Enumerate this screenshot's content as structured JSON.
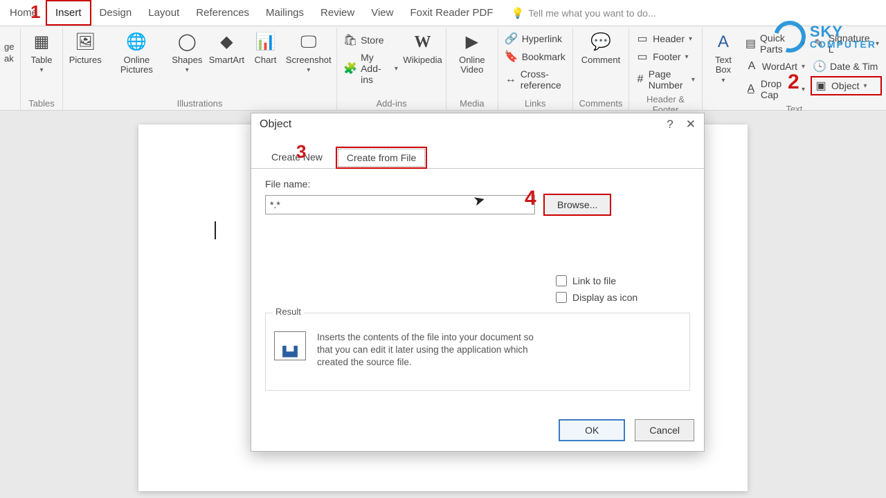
{
  "tabs": {
    "home": "Home",
    "insert": "Insert",
    "design": "Design",
    "layout": "Layout",
    "references": "References",
    "mailings": "Mailings",
    "review": "Review",
    "view": "View",
    "foxit": "Foxit Reader PDF",
    "tellme": "Tell me what you want to do..."
  },
  "ribbon": {
    "left_trunc_top": "ge",
    "left_trunc_bot": "ak",
    "tables": {
      "table": "Table",
      "group": "Tables"
    },
    "illus": {
      "pictures": "Pictures",
      "online_pictures": "Online Pictures",
      "shapes": "Shapes",
      "smartart": "SmartArt",
      "chart": "Chart",
      "screenshot": "Screenshot",
      "group": "Illustrations"
    },
    "addins": {
      "store": "Store",
      "myaddins": "My Add-ins",
      "wikipedia": "Wikipedia",
      "group": "Add-ins"
    },
    "media": {
      "online_video": "Online Video",
      "group": "Media"
    },
    "links": {
      "hyperlink": "Hyperlink",
      "bookmark": "Bookmark",
      "cross": "Cross-reference",
      "group": "Links"
    },
    "comments": {
      "comment": "Comment",
      "group": "Comments"
    },
    "hf": {
      "header": "Header",
      "footer": "Footer",
      "pagenum": "Page Number",
      "group": "Header & Footer"
    },
    "text": {
      "textbox": "Text Box",
      "quickparts": "Quick Parts",
      "wordart": "WordArt",
      "dropcap": "Drop Cap",
      "signature": "Signature L",
      "datetime": "Date & Tim",
      "object": "Object",
      "group": "Text"
    }
  },
  "dialog": {
    "title": "Object",
    "help": "?",
    "close": "✕",
    "tab_create_new": "Create New",
    "tab_create_file": "Create from File",
    "file_label": "File name:",
    "file_value": "*.*",
    "browse": "Browse...",
    "link": "Link to file",
    "display_icon": "Display as icon",
    "result_title": "Result",
    "result_text": "Inserts the contents of the file into your document so that you can edit it later using the application which created the source file.",
    "ok": "OK",
    "cancel": "Cancel"
  },
  "annotations": {
    "n1": "1",
    "n2": "2",
    "n3": "3",
    "n4": "4"
  },
  "watermark": {
    "line1": "SKY",
    "line2": "COMPUTER"
  }
}
